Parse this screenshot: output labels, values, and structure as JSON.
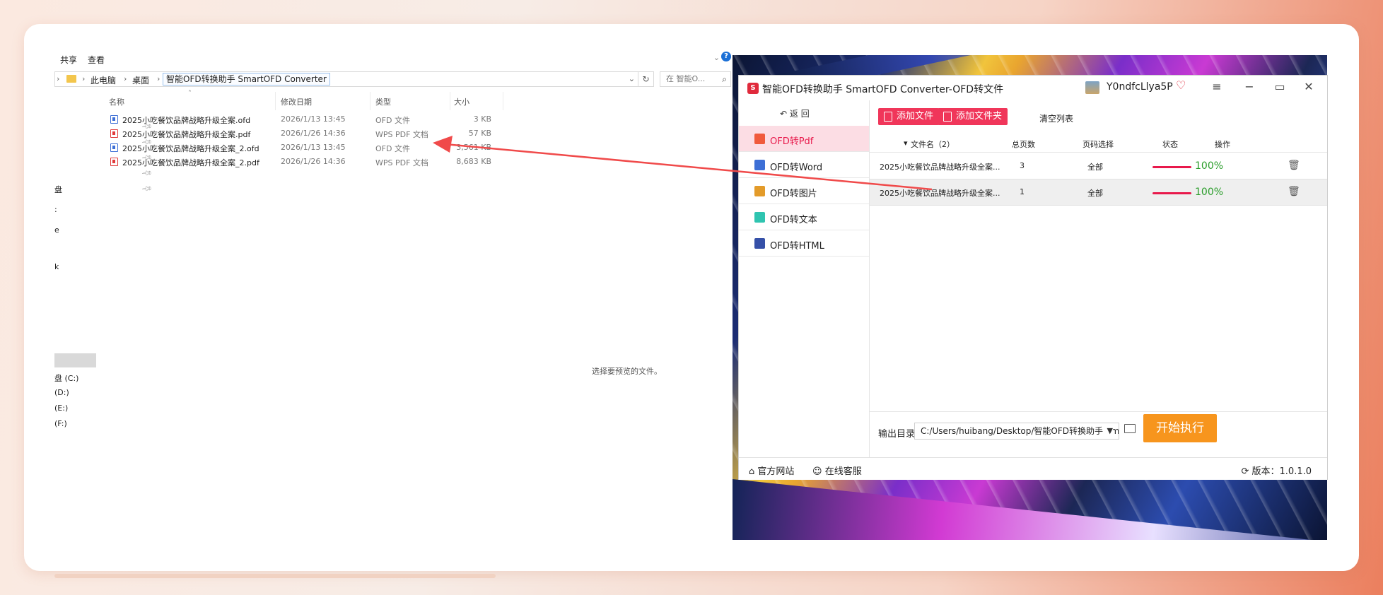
{
  "explorer": {
    "ribbon_tabs": [
      "共享",
      "查看"
    ],
    "ribbon_help": "?",
    "breadcrumb": [
      "此电脑",
      "桌面",
      "智能OFD转换助手 SmartOFD Converter"
    ],
    "search_placeholder": "在 智能O...",
    "columns": [
      "名称",
      "修改日期",
      "类型",
      "大小"
    ],
    "files": [
      {
        "name": "2025小吃餐饮品牌战略升级全案.ofd",
        "date": "2026/1/13 13:45",
        "type": "OFD 文件",
        "size": "3 KB",
        "kind": "ofd"
      },
      {
        "name": "2025小吃餐饮品牌战略升级全案.pdf",
        "date": "2026/1/26 14:36",
        "type": "WPS PDF 文档",
        "size": "57 KB",
        "kind": "pdf"
      },
      {
        "name": "2025小吃餐饮品牌战略升级全案_2.ofd",
        "date": "2026/1/13 13:45",
        "type": "OFD 文件",
        "size": "3,561 KB",
        "kind": "ofd"
      },
      {
        "name": "2025小吃餐饮品牌战略升级全案_2.pdf",
        "date": "2026/1/26 14:36",
        "type": "WPS PDF 文档",
        "size": "8,683 KB",
        "kind": "pdf"
      }
    ],
    "nav_fragments": [
      "盘",
      ":",
      "e",
      "k"
    ],
    "drives": [
      "盘 (C:)",
      "(D:)",
      "(E:)",
      "(F:)"
    ],
    "preview_message": "选择要预览的文件。"
  },
  "app": {
    "title": "智能OFD转换助手 SmartOFD Converter-OFD转文件",
    "logo_text": "S",
    "username": "Y0ndfcLlya5P",
    "back_label": "返 回",
    "nav": [
      {
        "label": "OFD转Pdf",
        "active": true,
        "color": "#f05a3c"
      },
      {
        "label": "OFD转Word",
        "active": false,
        "color": "#3d6fd6"
      },
      {
        "label": "OFD转图片",
        "active": false,
        "color": "#e39b2a"
      },
      {
        "label": "OFD转文本",
        "active": false,
        "color": "#2fc4b0"
      },
      {
        "label": "OFD转HTML",
        "active": false,
        "color": "#3550a8"
      }
    ],
    "add_file_label": "添加文件",
    "add_folder_label": "添加文件夹",
    "clear_label": "清空列表",
    "table_headers": {
      "filename": "文件名（2）",
      "pages": "总页数",
      "page_select": "页码选择",
      "status": "状态",
      "action": "操作"
    },
    "rows": [
      {
        "filename": "2025小吃餐饮品牌战略升级全案...",
        "pages": "3",
        "page_select": "全部",
        "progress": 1.0,
        "status": "100%"
      },
      {
        "filename": "2025小吃餐饮品牌战略升级全案...",
        "pages": "1",
        "page_select": "全部",
        "progress": 1.0,
        "status": "100%"
      }
    ],
    "output_label": "输出目录:",
    "output_path": "C:/Users/huibang/Desktop/智能OFD转换助手 SmartOFD Converter",
    "start_label": "开始执行",
    "footer": {
      "website": "官方网站",
      "support": "在线客服",
      "version": "版本：1.0.1.0"
    }
  },
  "colors": {
    "accent": "#f0365a",
    "active_text": "#e8194b",
    "start_button": "#f7951d",
    "success": "#2a9d2a",
    "arrow": "#f04a4a"
  }
}
